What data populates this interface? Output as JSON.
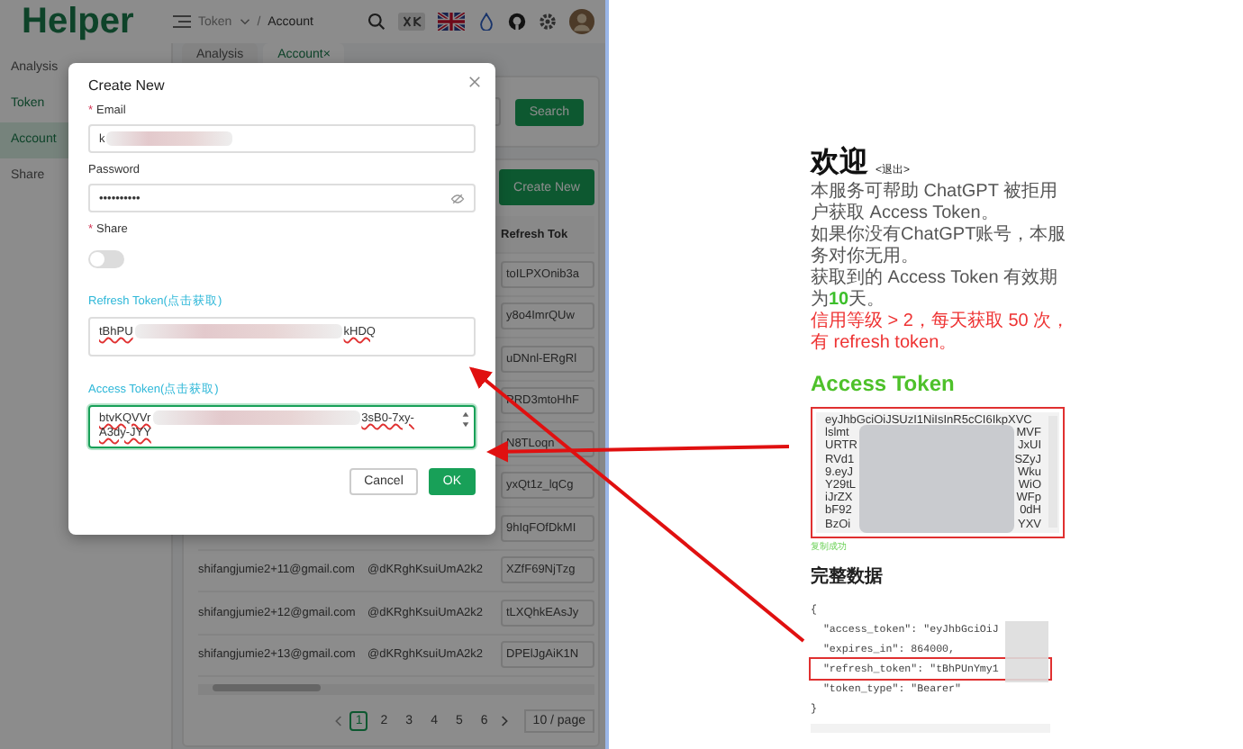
{
  "admin": {
    "logo": "Helper",
    "breadcrumb": [
      {
        "label": "Token",
        "dropdown": true
      },
      {
        "label": "Account"
      }
    ],
    "breadcrumb_separator": "/",
    "sidebar": [
      {
        "label": "Analysis",
        "kind": "item",
        "selected": false
      },
      {
        "label": "Token",
        "kind": "group",
        "selected": false
      },
      {
        "label": "Account",
        "kind": "item",
        "selected": true
      },
      {
        "label": "Share",
        "kind": "item",
        "selected": false
      }
    ],
    "tabs": [
      {
        "label": "Analysis",
        "selected": false
      },
      {
        "label": "Account",
        "selected": true,
        "close": "×"
      }
    ],
    "search_button": "Search",
    "create_button": "Create New",
    "table": {
      "columns": [
        {
          "label": "Refresh Tok"
        }
      ],
      "rows": [
        {
          "refresh_token": "toILPXOnib3a"
        },
        {
          "refresh_token": "y8o4ImrQUw"
        },
        {
          "refresh_token": "uDNnl-ERgRl"
        },
        {
          "refresh_token": "PRD3mtoHhF"
        },
        {
          "refresh_token": "N8TLoqn"
        },
        {
          "refresh_token": "yxQt1z_lqCg"
        },
        {
          "refresh_token": "9hIqFOfDkMI"
        },
        {
          "email": "shifangjumie2+11@gmail.com",
          "password": "@dKRghKsuiUmA2k2",
          "refresh_token": "XZfF69NjTzg"
        },
        {
          "email": "shifangjumie2+12@gmail.com",
          "password": "@dKRghKsuiUmA2k2",
          "refresh_token": "tLXQhkEAsJy"
        },
        {
          "email": "shifangjumie2+13@gmail.com",
          "password": "@dKRghKsuiUmA2k2",
          "refresh_token": "DPElJgAiK1N"
        }
      ]
    },
    "pagination": {
      "pages": [
        {
          "label": "1",
          "selected": true
        },
        {
          "label": "2",
          "selected": false
        },
        {
          "label": "3",
          "selected": false
        },
        {
          "label": "4",
          "selected": false
        },
        {
          "label": "5",
          "selected": false
        },
        {
          "label": "6",
          "selected": false
        }
      ],
      "page_size": "10 / page"
    }
  },
  "dialog": {
    "title": "Create New",
    "required_mark": "*",
    "email": {
      "label": "Email",
      "required": true,
      "value": "k"
    },
    "password": {
      "label": "Password",
      "required": false,
      "value": "••••••••••"
    },
    "share": {
      "label": "Share",
      "required": true,
      "on": false
    },
    "refresh_token": {
      "label": "Refresh Token(点击获取)",
      "start": "tBhPU",
      "end": "kHDQ",
      "focused": false
    },
    "access_token": {
      "label": "Access Token(点击获取)",
      "start": "btvKQVVr",
      "end": "3sB0-7xy-",
      "line2": "A3dy-JYY",
      "focused": true
    },
    "buttons": [
      {
        "label": "Cancel",
        "kind": "default"
      },
      {
        "label": "OK",
        "kind": "primary"
      }
    ]
  },
  "page": {
    "title": "欢迎",
    "logout": "<退出>",
    "intro": [
      "本服务可帮助 ChatGPT 被拒用户获取 Access Token。",
      "如果你没有ChatGPT账号，本服务对你无用。",
      "获取到的 Access Token 有效期为**10**天。"
    ],
    "warning": "信用等级 > 2，每天获取 50 次，有 refresh token。",
    "token_heading": "Access Token",
    "token_lines": [
      {
        "left": "eyJhbGciOiJSUzI1NiIsInR5cCI6IkpXVC"
      },
      {
        "left": "lslmt",
        "right": "MVF"
      },
      {
        "left": "URTR",
        "right": "JxUI"
      },
      {
        "left": "RVd1",
        "right": "SZyJ"
      },
      {
        "left": "9.eyJ",
        "right": "Wku"
      },
      {
        "left": "Y29tL",
        "right": "WiO"
      },
      {
        "left": "iJrZX",
        "right": "WFp"
      },
      {
        "left": "bF92",
        "right": "0dH"
      },
      {
        "left": "BzOi",
        "right": "YXV"
      }
    ],
    "copied": "复制成功",
    "data_heading": "完整数据",
    "json_lines": [
      {
        "text": "{",
        "highlight": false
      },
      {
        "text": "  \"access_token\": \"eyJhbGciOiJ",
        "highlight": false
      },
      {
        "text": "  \"expires_in\": 864000,",
        "highlight": false
      },
      {
        "text": "  \"refresh_token\": \"tBhPUnYmy1",
        "highlight": true
      },
      {
        "text": "  \"token_type\": \"Bearer\"",
        "highlight": false
      },
      {
        "text": "}",
        "highlight": false
      }
    ]
  }
}
